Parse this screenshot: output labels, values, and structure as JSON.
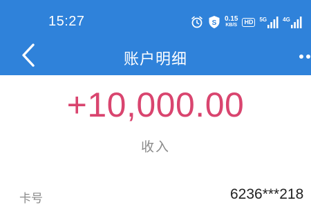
{
  "status_bar": {
    "time": "15:27",
    "net_speed_value": "0.15",
    "net_speed_unit": "KB/S",
    "hd_label": "HD",
    "signal_1_label": "5G",
    "signal_2_label": "4G",
    "icons": [
      "alarm-icon",
      "shield-s-icon",
      "net-speed",
      "hd-badge",
      "signal-5g-icon",
      "signal-4g-icon"
    ]
  },
  "header": {
    "title": "账户明细",
    "back_icon": "chevron-left-icon",
    "more_icon": "more-dots-icon"
  },
  "detail": {
    "amount": "+10,000.00",
    "type": "收入",
    "rows": [
      {
        "label": "卡号",
        "value": "6236***218"
      }
    ]
  },
  "colors": {
    "header_bg": "#2f82da",
    "amount": "#d9456f",
    "muted_text": "#8a8a8a",
    "body_text": "#222222"
  }
}
